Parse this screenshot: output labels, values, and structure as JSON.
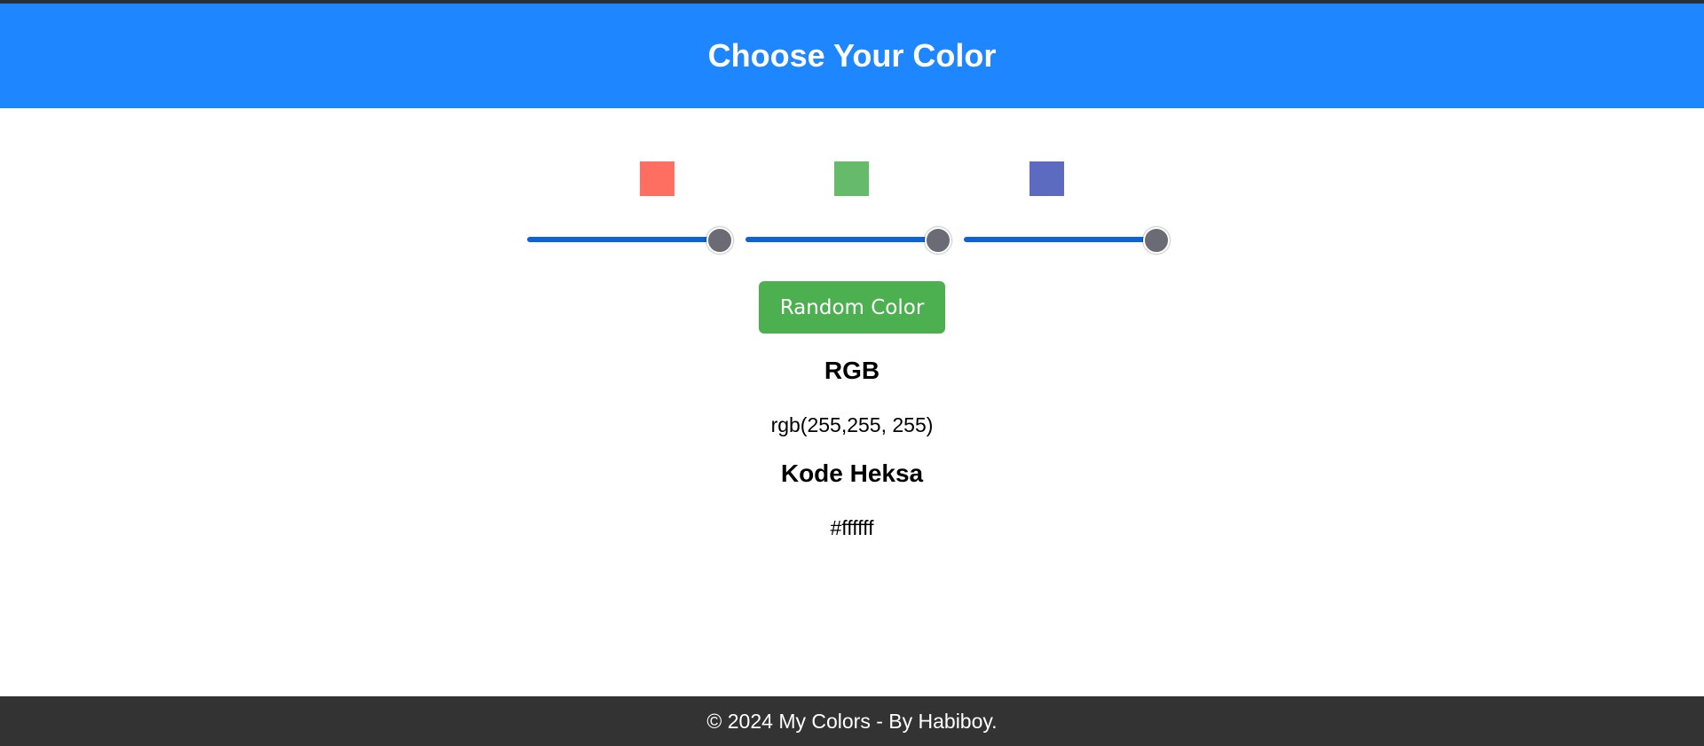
{
  "header": {
    "title": "Choose Your Color"
  },
  "swatches": [
    {
      "name": "red",
      "color": "#ff6f61"
    },
    {
      "name": "green",
      "color": "#66bb6a"
    },
    {
      "name": "blue",
      "color": "#5c6bc0"
    }
  ],
  "sliders": {
    "red": 255,
    "green": 255,
    "blue": 255,
    "min": 0,
    "max": 255
  },
  "buttons": {
    "random_label": "Random Color"
  },
  "output": {
    "rgb_heading": "RGB",
    "rgb_value": "rgb(255,255, 255)",
    "hex_heading": "Kode Heksa",
    "hex_value": "#ffffff"
  },
  "footer": {
    "text": "© 2024 My Colors - By Habiboy."
  },
  "colors": {
    "header_bg": "#1e86ff",
    "slider_track": "#0b63d6",
    "slider_thumb": "#6b6b75",
    "button_bg": "#4caf50",
    "footer_bg": "#333333"
  }
}
